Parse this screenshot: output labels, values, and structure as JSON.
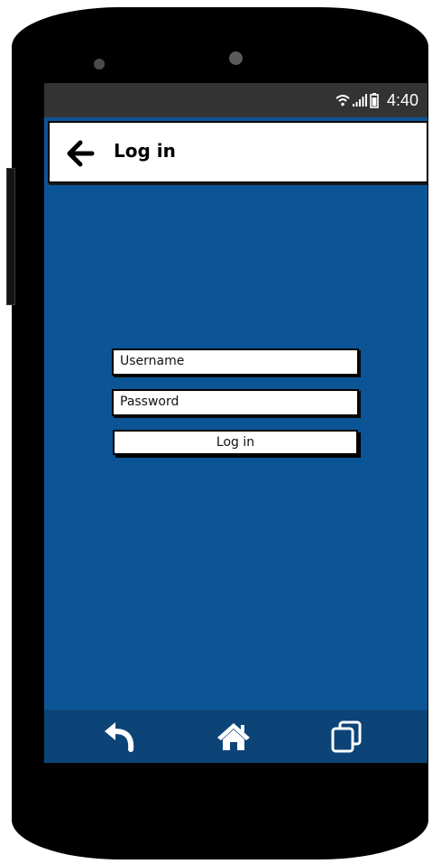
{
  "status_bar": {
    "time": "4:40",
    "icons": [
      "wifi-icon",
      "signal-icon",
      "battery-icon"
    ]
  },
  "app_bar": {
    "back_icon": "arrow-left-icon",
    "title": "Log in"
  },
  "login_form": {
    "username_placeholder": "Username",
    "password_placeholder": "Password",
    "submit_label": "Log in"
  },
  "nav_bar": {
    "items": [
      "back-icon",
      "home-icon",
      "recents-icon"
    ]
  },
  "colors": {
    "screen_background": "#0b5596",
    "nav_bar_background": "#0d4478",
    "status_bar_background": "#333333",
    "phone_body": "#000000"
  }
}
